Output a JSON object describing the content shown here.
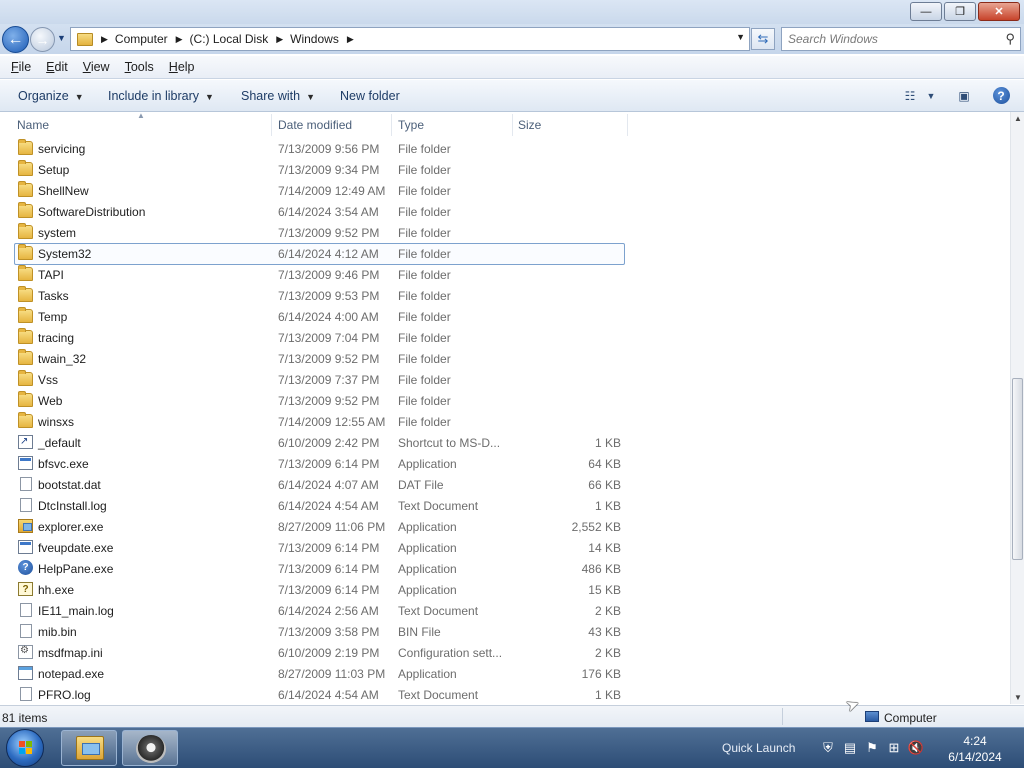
{
  "window": {
    "minimize_glyph": "—",
    "maximize_glyph": "❐",
    "close_glyph": "✕"
  },
  "address": {
    "crumbs": [
      "Computer",
      "(C:) Local Disk",
      "Windows"
    ],
    "search_placeholder": "Search Windows"
  },
  "menu": {
    "items": [
      {
        "key": "F",
        "rest": "ile"
      },
      {
        "key": "E",
        "rest": "dit"
      },
      {
        "key": "V",
        "rest": "iew"
      },
      {
        "key": "T",
        "rest": "ools"
      },
      {
        "key": "H",
        "rest": "elp"
      }
    ]
  },
  "commands": {
    "organize": "Organize",
    "include_in_library": "Include in library",
    "share_with": "Share with",
    "new_folder": "New folder"
  },
  "columns": {
    "name": "Name",
    "date_modified": "Date modified",
    "type": "Type",
    "size": "Size"
  },
  "files": [
    {
      "name": "servicing",
      "date": "7/13/2009 9:56 PM",
      "type": "File folder",
      "size": "",
      "icon": "folder-icon"
    },
    {
      "name": "Setup",
      "date": "7/13/2009 9:34 PM",
      "type": "File folder",
      "size": "",
      "icon": "folder-icon"
    },
    {
      "name": "ShellNew",
      "date": "7/14/2009 12:49 AM",
      "type": "File folder",
      "size": "",
      "icon": "folder-icon"
    },
    {
      "name": "SoftwareDistribution",
      "date": "6/14/2024 3:54 AM",
      "type": "File folder",
      "size": "",
      "icon": "folder-icon"
    },
    {
      "name": "system",
      "date": "7/13/2009 9:52 PM",
      "type": "File folder",
      "size": "",
      "icon": "folder-icon"
    },
    {
      "name": "System32",
      "date": "6/14/2024 4:12 AM",
      "type": "File folder",
      "size": "",
      "icon": "folder-icon",
      "selected": true
    },
    {
      "name": "TAPI",
      "date": "7/13/2009 9:46 PM",
      "type": "File folder",
      "size": "",
      "icon": "folder-icon"
    },
    {
      "name": "Tasks",
      "date": "7/13/2009 9:53 PM",
      "type": "File folder",
      "size": "",
      "icon": "folder-icon"
    },
    {
      "name": "Temp",
      "date": "6/14/2024 4:00 AM",
      "type": "File folder",
      "size": "",
      "icon": "folder-icon"
    },
    {
      "name": "tracing",
      "date": "7/13/2009 7:04 PM",
      "type": "File folder",
      "size": "",
      "icon": "folder-icon"
    },
    {
      "name": "twain_32",
      "date": "7/13/2009 9:52 PM",
      "type": "File folder",
      "size": "",
      "icon": "folder-icon"
    },
    {
      "name": "Vss",
      "date": "7/13/2009 7:37 PM",
      "type": "File folder",
      "size": "",
      "icon": "folder-icon"
    },
    {
      "name": "Web",
      "date": "7/13/2009 9:52 PM",
      "type": "File folder",
      "size": "",
      "icon": "folder-icon"
    },
    {
      "name": "winsxs",
      "date": "7/14/2009 12:55 AM",
      "type": "File folder",
      "size": "",
      "icon": "folder-icon"
    },
    {
      "name": "_default",
      "date": "6/10/2009 2:42 PM",
      "type": "Shortcut to MS-D...",
      "size": "1 KB",
      "icon": "shortcut-icon"
    },
    {
      "name": "bfsvc.exe",
      "date": "7/13/2009 6:14 PM",
      "type": "Application",
      "size": "64 KB",
      "icon": "app-icon"
    },
    {
      "name": "bootstat.dat",
      "date": "6/14/2024 4:07 AM",
      "type": "DAT File",
      "size": "66 KB",
      "icon": "doc-icon"
    },
    {
      "name": "DtcInstall.log",
      "date": "6/14/2024 4:54 AM",
      "type": "Text Document",
      "size": "1 KB",
      "icon": "doc-icon"
    },
    {
      "name": "explorer.exe",
      "date": "8/27/2009 11:06 PM",
      "type": "Application",
      "size": "2,552 KB",
      "icon": "explorer-icon"
    },
    {
      "name": "fveupdate.exe",
      "date": "7/13/2009 6:14 PM",
      "type": "Application",
      "size": "14 KB",
      "icon": "app-icon"
    },
    {
      "name": "HelpPane.exe",
      "date": "7/13/2009 6:14 PM",
      "type": "Application",
      "size": "486 KB",
      "icon": "help-file-icon"
    },
    {
      "name": "hh.exe",
      "date": "7/13/2009 6:14 PM",
      "type": "Application",
      "size": "15 KB",
      "icon": "hh-icon"
    },
    {
      "name": "IE11_main.log",
      "date": "6/14/2024 2:56 AM",
      "type": "Text Document",
      "size": "2 KB",
      "icon": "doc-icon"
    },
    {
      "name": "mib.bin",
      "date": "7/13/2009 3:58 PM",
      "type": "BIN File",
      "size": "43 KB",
      "icon": "doc-icon"
    },
    {
      "name": "msdfmap.ini",
      "date": "6/10/2009 2:19 PM",
      "type": "Configuration sett...",
      "size": "2 KB",
      "icon": "ini-icon"
    },
    {
      "name": "notepad.exe",
      "date": "8/27/2009 11:03 PM",
      "type": "Application",
      "size": "176 KB",
      "icon": "notepad-icon"
    },
    {
      "name": "PFRO.log",
      "date": "6/14/2024 4:54 AM",
      "type": "Text Document",
      "size": "1 KB",
      "icon": "doc-icon"
    }
  ],
  "status": {
    "item_count": "81 items",
    "location": "Computer"
  },
  "taskbar": {
    "quick_launch": "Quick Launch",
    "time": "4:24",
    "date": "6/14/2024"
  },
  "colors": {
    "selection_border": "#7da2ce",
    "taskbar": "#2d4d76",
    "folder": "#e6b541"
  }
}
